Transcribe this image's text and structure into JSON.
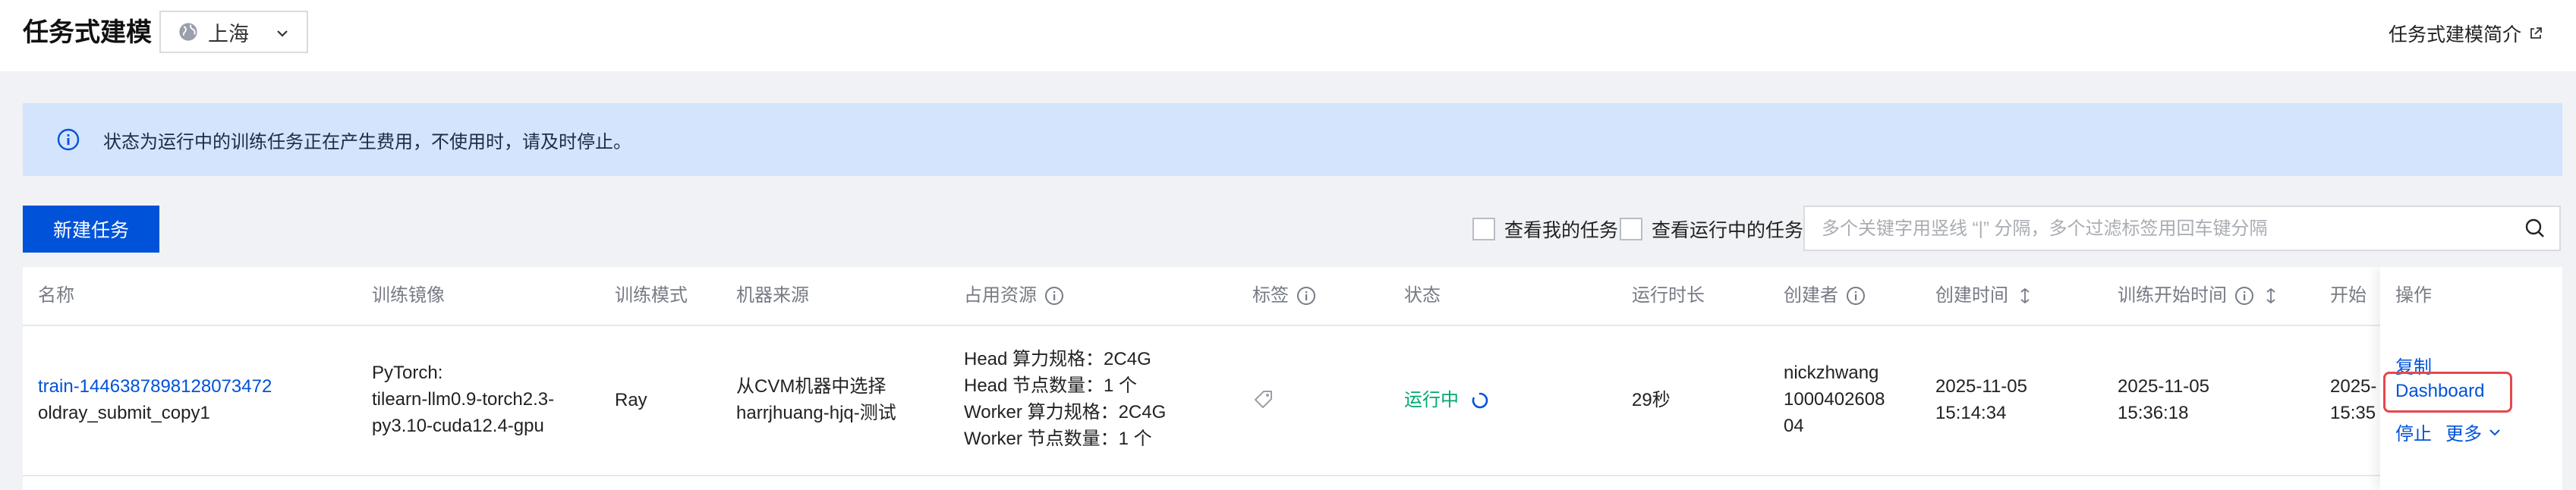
{
  "header": {
    "title": "任务式建模",
    "region": "上海",
    "intro_link": "任务式建模简介"
  },
  "notice": {
    "text": "状态为运行中的训练任务正在产生费用，不使用时，请及时停止。"
  },
  "toolbar": {
    "new_task": "新建任务",
    "filter_mine": "查看我的任务",
    "filter_running": "查看运行中的任务",
    "search_placeholder": "多个关键字用竖线 “|” 分隔，多个过滤标签用回车键分隔"
  },
  "table": {
    "columns": {
      "name": "名称",
      "image": "训练镜像",
      "mode": "训练模式",
      "machine": "机器来源",
      "resources": "占用资源",
      "tags": "标签",
      "status": "状态",
      "duration": "运行时长",
      "creator": "创建者",
      "created_at": "创建时间",
      "started_at": "训练开始时间",
      "start_clipped": "开始",
      "actions": "操作"
    },
    "rows": [
      {
        "id": "train-1446387898128073472",
        "name": "oldray_submit_copy1",
        "image_lines": [
          "PyTorch:",
          "tilearn-llm0.9-torch2.3-",
          "py3.10-cuda12.4-gpu"
        ],
        "mode": "Ray",
        "machine_lines": [
          "从CVM机器中选择",
          "harrjhuang-hjq-测试"
        ],
        "resource_lines": [
          "Head 算力规格：2C4G",
          "Head 节点数量：1 个",
          "Worker 算力规格：2C4G",
          "Worker 节点数量：1 个"
        ],
        "status": "运行中",
        "duration": "29秒",
        "creator_lines": [
          "nickzhwang",
          "1000402608",
          "04"
        ],
        "created_date": "2025-11-05",
        "created_time": "15:14:34",
        "started_date": "2025-11-05",
        "started_time": "15:36:18",
        "clip_date": "2025-",
        "clip_time": "15:35",
        "actions": {
          "copy": "复制",
          "dashboard": "Dashboard",
          "stop": "停止",
          "more": "更多"
        }
      }
    ]
  },
  "colors": {
    "primary": "#0052d9",
    "notice_bg": "#d4e4fd",
    "running": "#00a870",
    "highlight": "#e5484d"
  },
  "icons": [
    "globe-icon",
    "chevron-down-icon",
    "external-link-icon",
    "info-icon",
    "search-icon",
    "help-circle-icon",
    "sort-icon",
    "tag-icon",
    "loading-icon"
  ]
}
